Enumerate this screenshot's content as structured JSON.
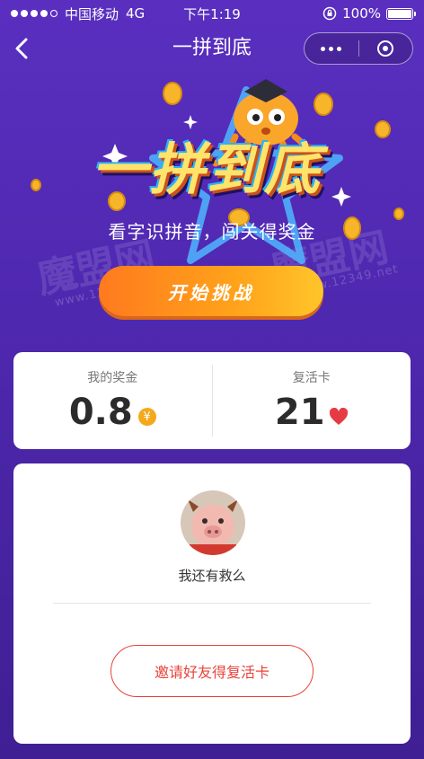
{
  "status_bar": {
    "carrier": "中国移动",
    "network": "4G",
    "time": "下午1:19",
    "battery": "100%"
  },
  "nav": {
    "back_icon": "chevron-left-icon",
    "title": "一拼到底",
    "more_icon": "more-dots-icon",
    "close_icon": "target-ring-icon"
  },
  "hero": {
    "logo_text": "一拼到底",
    "slogan": "看字识拼音，闯关得奖金",
    "start_label": "开始挑战"
  },
  "stats": {
    "bonus_label": "我的奖金",
    "bonus_value": "0.8",
    "bonus_icon": "yen-coin-icon",
    "revive_label": "复活卡",
    "revive_value": "21",
    "revive_icon": "heart-icon"
  },
  "invite": {
    "avatar_icon": "pig-avatar",
    "caption": "我还有救么",
    "button_label": "邀请好友得复活卡"
  },
  "watermark": {
    "brand": "魔盟网",
    "url": "www.12349.net"
  },
  "colors": {
    "background": "#5a2fc0",
    "start_button": "#ff9a1e",
    "invite_accent": "#e9423a",
    "coin": "#f4a91d",
    "heart": "#e53b45"
  }
}
